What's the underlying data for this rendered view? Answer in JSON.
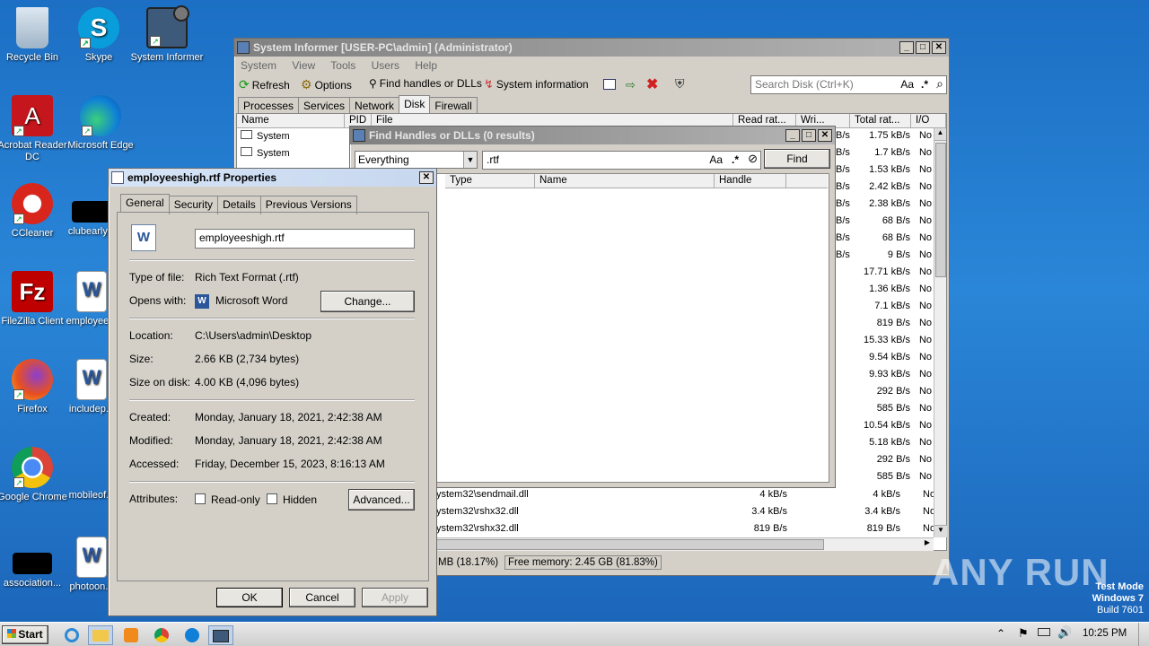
{
  "desktop": {
    "icons": [
      {
        "label": "Recycle Bin"
      },
      {
        "label": "Skype"
      },
      {
        "label": "System Informer"
      },
      {
        "label": "Acrobat Reader DC"
      },
      {
        "label": "Microsoft Edge"
      },
      {
        "label": "CCleaner"
      },
      {
        "label": "clubearly..."
      },
      {
        "label": "FileZilla Client"
      },
      {
        "label": "employee..."
      },
      {
        "label": "Firefox"
      },
      {
        "label": "includep..."
      },
      {
        "label": "Google Chrome"
      },
      {
        "label": "mobileof..."
      },
      {
        "label": "association..."
      },
      {
        "label": "photoon..."
      }
    ],
    "watermark": {
      "brand": "ANY RUN",
      "line1": "Test Mode",
      "line2": "Windows 7",
      "line3": "Build 7601"
    }
  },
  "system_informer": {
    "title": "System Informer [USER-PC\\admin] (Administrator)",
    "menu": [
      "System",
      "View",
      "Tools",
      "Users",
      "Help"
    ],
    "toolbar": {
      "refresh": "Refresh",
      "options": "Options",
      "find_handles": "Find handles or DLLs",
      "system_info": "System information"
    },
    "search_placeholder": "Search Disk (Ctrl+K)",
    "search_case": "Aa",
    "search_regex": ".*",
    "tabs": [
      "Processes",
      "Services",
      "Network",
      "Disk",
      "Firewall"
    ],
    "active_tab": "Disk",
    "columns": [
      "Name",
      "PID",
      "File",
      "Read rat...",
      "Wri...",
      "Total rat...",
      "I/O"
    ],
    "left_rows": [
      "System",
      "System"
    ],
    "rates": [
      {
        "a": "B/s",
        "total": "1.75 kB/s",
        "io": "No"
      },
      {
        "a": "B/s",
        "total": "1.7 kB/s",
        "io": "No"
      },
      {
        "a": "B/s",
        "total": "1.53 kB/s",
        "io": "No"
      },
      {
        "a": "B/s",
        "total": "2.42 kB/s",
        "io": "No"
      },
      {
        "a": "B/s",
        "total": "2.38 kB/s",
        "io": "No"
      },
      {
        "a": "B/s",
        "total": "68 B/s",
        "io": "No"
      },
      {
        "a": "B/s",
        "total": "68 B/s",
        "io": "No"
      },
      {
        "a": "B/s",
        "total": "9 B/s",
        "io": "No"
      },
      {
        "a": "",
        "total": "17.71 kB/s",
        "io": "No"
      },
      {
        "a": "",
        "total": "1.36 kB/s",
        "io": "No"
      },
      {
        "a": "",
        "total": "7.1 kB/s",
        "io": "No"
      },
      {
        "a": "",
        "total": "819 B/s",
        "io": "No"
      },
      {
        "a": "",
        "total": "15.33 kB/s",
        "io": "No"
      },
      {
        "a": "",
        "total": "9.54 kB/s",
        "io": "No"
      },
      {
        "a": "",
        "total": "9.93 kB/s",
        "io": "No"
      },
      {
        "a": "",
        "total": "292 B/s",
        "io": "No"
      },
      {
        "a": "",
        "total": "585 B/s",
        "io": "No"
      },
      {
        "a": "",
        "total": "10.54 kB/s",
        "io": "No"
      },
      {
        "a": "",
        "total": "5.18 kB/s",
        "io": "No"
      },
      {
        "a": "",
        "total": "292 B/s",
        "io": "No"
      },
      {
        "a": "",
        "total": "585 B/s",
        "io": "No"
      }
    ],
    "bottom_rows": [
      {
        "file": "ystem32\\sendmail.dll",
        "read": "4 kB/s",
        "total": "4 kB/s",
        "io": "No"
      },
      {
        "file": "ystem32\\rshx32.dll",
        "read": "3.4 kB/s",
        "total": "3.4 kB/s",
        "io": "No"
      },
      {
        "file": "ystem32\\rshx32.dll",
        "read": "819 B/s",
        "total": "819 B/s",
        "io": "No"
      }
    ],
    "status": {
      "mem_used": "MB (18.17%)",
      "free_memory": "Free memory: 2.45 GB (81.83%)"
    }
  },
  "find_handles": {
    "title": "Find Handles or DLLs (0 results)",
    "filter_type": "Everything",
    "query": ".rtf",
    "case": "Aa",
    "regex": ".*",
    "find_button": "Find",
    "columns": [
      "Type",
      "Name",
      "Handle"
    ]
  },
  "properties": {
    "title": "employeeshigh.rtf Properties",
    "tabs": [
      "General",
      "Security",
      "Details",
      "Previous Versions"
    ],
    "active_tab": "General",
    "filename": "employeeshigh.rtf",
    "type_label": "Type of file:",
    "type_value": "Rich Text Format (.rtf)",
    "opens_label": "Opens with:",
    "opens_value": "Microsoft Word",
    "change_button": "Change...",
    "location_label": "Location:",
    "location_value": "C:\\Users\\admin\\Desktop",
    "size_label": "Size:",
    "size_value": "2.66 KB (2,734 bytes)",
    "disk_label": "Size on disk:",
    "disk_value": "4.00 KB (4,096 bytes)",
    "created_label": "Created:",
    "created_value": "Monday, January 18, 2021, 2:42:38 AM",
    "modified_label": "Modified:",
    "modified_value": "Monday, January 18, 2021, 2:42:38 AM",
    "accessed_label": "Accessed:",
    "accessed_value": "Friday, December 15, 2023, 8:16:13 AM",
    "attributes_label": "Attributes:",
    "readonly_label": "Read-only",
    "hidden_label": "Hidden",
    "advanced_button": "Advanced...",
    "ok_button": "OK",
    "cancel_button": "Cancel",
    "apply_button": "Apply"
  },
  "taskbar": {
    "start": "Start",
    "clock": "10:25 PM"
  }
}
